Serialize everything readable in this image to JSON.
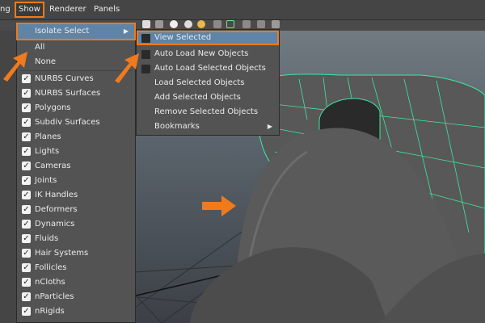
{
  "menubar": {
    "items": [
      {
        "label": "ng"
      },
      {
        "label": "Show"
      },
      {
        "label": "Renderer"
      },
      {
        "label": "Panels"
      }
    ]
  },
  "show_menu": {
    "items": [
      {
        "label": "Isolate Select",
        "type": "submenu"
      },
      {
        "label": "All",
        "type": "plain"
      },
      {
        "label": "None",
        "type": "plain"
      },
      {
        "label": "NURBS Curves",
        "checked": true
      },
      {
        "label": "NURBS Surfaces",
        "checked": true
      },
      {
        "label": "Polygons",
        "checked": true
      },
      {
        "label": "Subdiv Surfaces",
        "checked": true
      },
      {
        "label": "Planes",
        "checked": true
      },
      {
        "label": "Lights",
        "checked": true
      },
      {
        "label": "Cameras",
        "checked": true
      },
      {
        "label": "Joints",
        "checked": true
      },
      {
        "label": "IK Handles",
        "checked": true
      },
      {
        "label": "Deformers",
        "checked": true
      },
      {
        "label": "Dynamics",
        "checked": true
      },
      {
        "label": "Fluids",
        "checked": true
      },
      {
        "label": "Hair Systems",
        "checked": true
      },
      {
        "label": "Follicles",
        "checked": true
      },
      {
        "label": "nCloths",
        "checked": true
      },
      {
        "label": "nParticles",
        "checked": true
      },
      {
        "label": "nRigids",
        "checked": true
      }
    ]
  },
  "isolate_submenu": {
    "items": [
      {
        "label": "View Selected",
        "checkbox": true
      },
      {
        "label": "Auto Load New Objects",
        "checkbox": true
      },
      {
        "label": "Auto Load Selected Objects",
        "checkbox": true
      },
      {
        "label": "Load Selected Objects"
      },
      {
        "label": "Add Selected Objects"
      },
      {
        "label": "Remove Selected Objects"
      },
      {
        "label": "Bookmarks",
        "type": "submenu"
      }
    ]
  },
  "colors": {
    "highlight": "#5e84a8",
    "annotation": "#f07a1c",
    "wireframe": "#3de8a0"
  },
  "icons": {
    "check": "checkmark-icon",
    "arrow": "submenu-arrow-icon",
    "annotation": "annotation-arrow-icon"
  }
}
